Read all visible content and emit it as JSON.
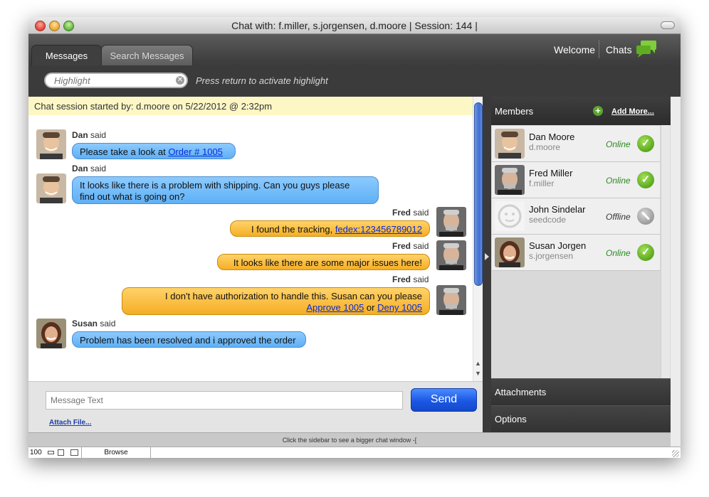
{
  "window": {
    "title": "Chat with: f.miller, s.jorgensen, d.moore | Session: 144 |"
  },
  "header": {
    "tabs": [
      {
        "label": "Messages",
        "active": true
      },
      {
        "label": "Search Messages",
        "active": false
      }
    ],
    "welcome": "Welcome",
    "chats": "Chats",
    "highlight_placeholder": "Highlight",
    "highlight_hint": "Press return to activate highlight"
  },
  "chat": {
    "session_info": "Chat session started by: d.moore on 5/22/2012 @ 2:32pm",
    "said_word": "said",
    "messages": [
      {
        "author": "Dan",
        "side": "left",
        "pre": "Please take a look at ",
        "link": "Order # 1005"
      },
      {
        "author": "Dan",
        "side": "left",
        "line1": "It looks like there is a problem with shipping. Can you guys please",
        "line2": "find out what is going on?"
      },
      {
        "author": "Fred",
        "side": "right",
        "pre": "I found the tracking, ",
        "link": "fedex:123456789012"
      },
      {
        "author": "Fred",
        "side": "right",
        "text": "It looks like there are some major issues here!"
      },
      {
        "author": "Fred",
        "side": "right",
        "line1": "I don't have authorization to handle this. Susan can you please",
        "link1": "Approve 1005",
        "mid": " or ",
        "link2": "Deny 1005"
      },
      {
        "author": "Susan",
        "side": "left",
        "text": "Problem has been resolved and i approved the order"
      }
    ]
  },
  "composer": {
    "placeholder": "Message Text",
    "send_label": "Send",
    "attach_label": "Attach File..."
  },
  "sidebar": {
    "members_title": "Members",
    "add_more": "Add More...",
    "members": [
      {
        "name": "Dan Moore",
        "username": "d.moore",
        "status": "Online"
      },
      {
        "name": "Fred Miller",
        "username": "f.miller",
        "status": "Online"
      },
      {
        "name": "John Sindelar",
        "username": "seedcode",
        "status": "Offline"
      },
      {
        "name": "Susan Jorgen",
        "username": "s.jorgensen",
        "status": "Online"
      }
    ],
    "attachments": "Attachments",
    "options": "Options"
  },
  "footer": {
    "hint": "Click the sidebar to see a bigger chat window -["
  },
  "statusbar": {
    "zoom": "100",
    "mode": "Browse"
  },
  "colors": {
    "accent_blue": "#1b57e4",
    "bubble_blue": "#5fb0f5",
    "bubble_orange": "#f5ae24",
    "online_green": "#5aa81e",
    "session_bar": "#fcf7c5"
  },
  "icons": {
    "add": "plus-circle-icon",
    "online": "checkmark-icon",
    "offline": "blocked-icon",
    "chats": "chat-bubbles-icon",
    "clear": "clear-x-icon"
  }
}
